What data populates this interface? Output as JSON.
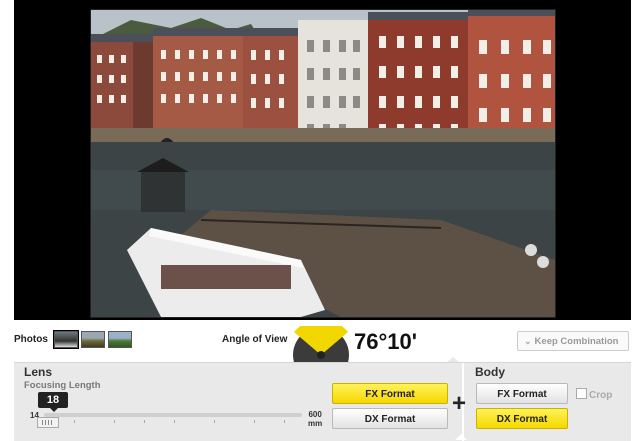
{
  "photos": {
    "label": "Photos",
    "thumbs": [
      {
        "name": "boat-canal-thumb",
        "selected": true
      },
      {
        "name": "field-landscape-thumb",
        "selected": false
      },
      {
        "name": "green-landscape-thumb",
        "selected": false
      }
    ]
  },
  "angle_of_view": {
    "label": "Angle of View",
    "value": "76°10'"
  },
  "keep_combination": {
    "label": "Keep Combination",
    "icon": "chevron-down-icon"
  },
  "lens": {
    "title": "Lens",
    "focusing_length_label": "Focusing Length",
    "current_focal": "18",
    "min": "14",
    "max": "600",
    "unit": "mm",
    "fx_label": "FX Format",
    "dx_label": "DX Format",
    "selected": "FX"
  },
  "body": {
    "title": "Body",
    "fx_label": "FX Format",
    "dx_label": "DX Format",
    "selected": "DX",
    "crop_label": "Crop"
  },
  "colors": {
    "accent_yellow": "#f5d800",
    "panel_grey": "#e9e9e9"
  }
}
